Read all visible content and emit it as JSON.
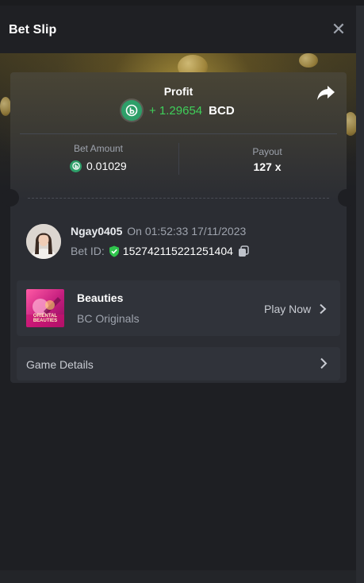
{
  "header": {
    "title": "Bet Slip"
  },
  "profit": {
    "label": "Profit",
    "value": "+ 1.29654",
    "currency": "BCD"
  },
  "bet_amount": {
    "label": "Bet Amount",
    "value": "0.01029"
  },
  "payout": {
    "label": "Payout",
    "value": "127 x"
  },
  "user": {
    "name": "Ngay0405",
    "timestamp": "On 01:52:33 17/11/2023",
    "bet_id_label": "Bet ID:",
    "bet_id": "152742115221251404"
  },
  "game": {
    "name": "Beauties",
    "provider": "BC Originals",
    "thumb_text": "ORIENTAL BEAUTIES",
    "play_label": "Play Now"
  },
  "details": {
    "label": "Game Details"
  },
  "colors": {
    "accent_green": "#3fcf5a",
    "coin_green": "#2e9f69",
    "panel": "#2b2d33"
  }
}
